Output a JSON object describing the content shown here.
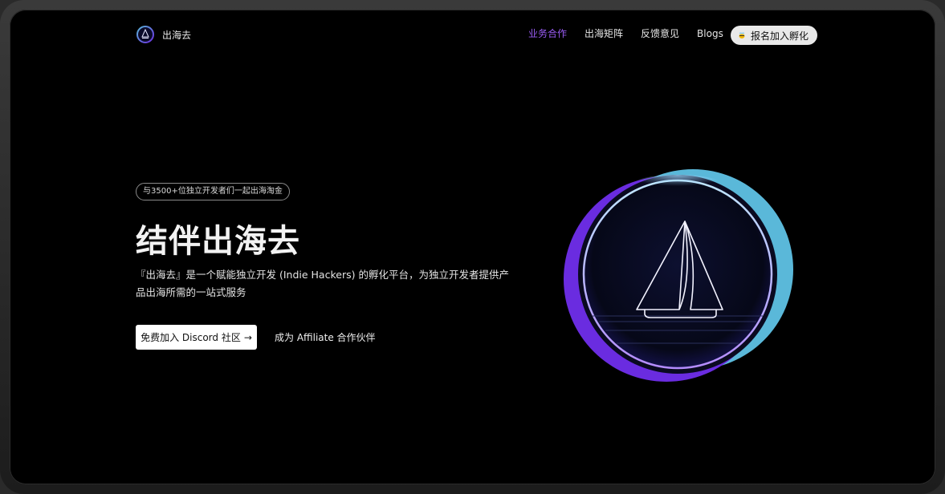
{
  "brand": {
    "name": "出海去"
  },
  "nav": {
    "links": [
      {
        "label": "业务合作",
        "active": true
      },
      {
        "label": "出海矩阵",
        "active": false
      },
      {
        "label": "反馈意见",
        "active": false
      },
      {
        "label": "Blogs",
        "active": false
      }
    ],
    "cta_label": "报名加入孵化",
    "cta_icon": "bee-icon"
  },
  "hero": {
    "badge": "与3500+位独立开发者们一起出海淘金",
    "title": "结伴出海去",
    "description": "『出海去』是一个赋能独立开发 (Indie Hackers) 的孵化平台，为独立开发者提供产品出海所需的一站式服务",
    "primary_button": "免费加入 Discord 社区",
    "primary_button_arrow": "→",
    "secondary_link": "成为 Affiliate 合作伙伴"
  },
  "colors": {
    "accent_purple": "#9a5cf5",
    "ring_blue": "#5ab8d9",
    "ring_violet": "#6a2ce0",
    "background": "#000000"
  }
}
